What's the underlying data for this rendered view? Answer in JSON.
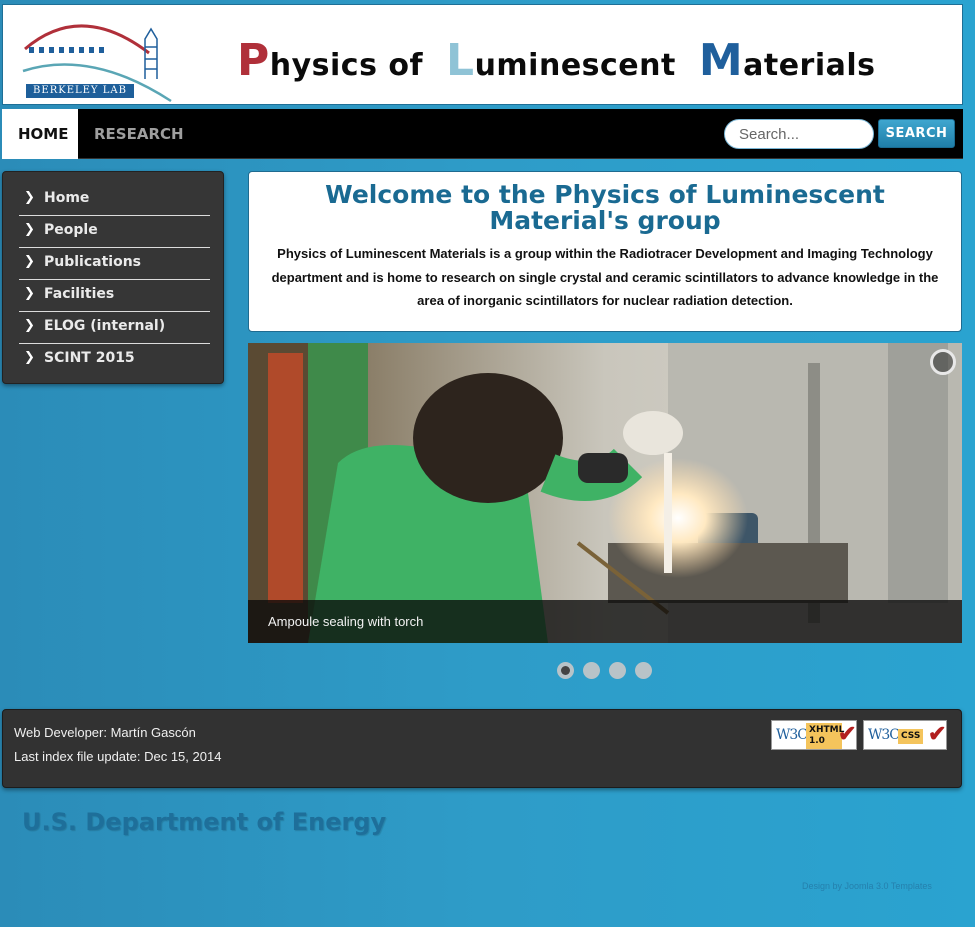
{
  "header": {
    "logo_text": "BERKELEY LAB",
    "title_parts": [
      {
        "initial": "P",
        "rest": "hysics of"
      },
      {
        "initial": "L",
        "rest": "uminescent"
      },
      {
        "initial": "M",
        "rest": "aterials"
      }
    ],
    "colors": {
      "p": "#b0303a",
      "l": "#8fc3d6",
      "m": "#1f5f9c"
    }
  },
  "navbar": {
    "items": [
      {
        "label": "HOME",
        "active": true
      },
      {
        "label": "RESEARCH",
        "active": false
      }
    ],
    "search": {
      "placeholder": "Search...",
      "button_label": "SEARCH"
    }
  },
  "sidebar": {
    "items": [
      {
        "label": "Home"
      },
      {
        "label": "People"
      },
      {
        "label": "Publications"
      },
      {
        "label": "Facilities"
      },
      {
        "label": "ELOG (internal)"
      },
      {
        "label": "SCINT 2015"
      }
    ],
    "icon": "chevron-right-icon"
  },
  "welcome": {
    "heading": "Welcome to the Physics of Luminescent Material's group",
    "body": "Physics of Luminescent Materials is a group within the Radiotracer Development and Imaging Technology department  and is home to research on single crystal and ceramic scintillators to advance knowledge in the area of  inorganic scintillators for nuclear radiation detection."
  },
  "slider": {
    "caption": "Ampoule sealing with torch",
    "slide_count": 4,
    "active_slide": 1
  },
  "footer": {
    "developer": "Web Developer: Martín Gascón",
    "last_update": "Last index file update: Dec 15, 2014",
    "badges": [
      {
        "org": "W3C",
        "label": "XHTML 1.0"
      },
      {
        "org": "W3C",
        "label": "CSS"
      }
    ]
  },
  "bottom": {
    "department": "U.S. Department of Energy",
    "credit": "Design by Joomla 3.0 Templates"
  },
  "theme": {
    "accent": "#1a6a92",
    "background": "#2e9cc8"
  }
}
